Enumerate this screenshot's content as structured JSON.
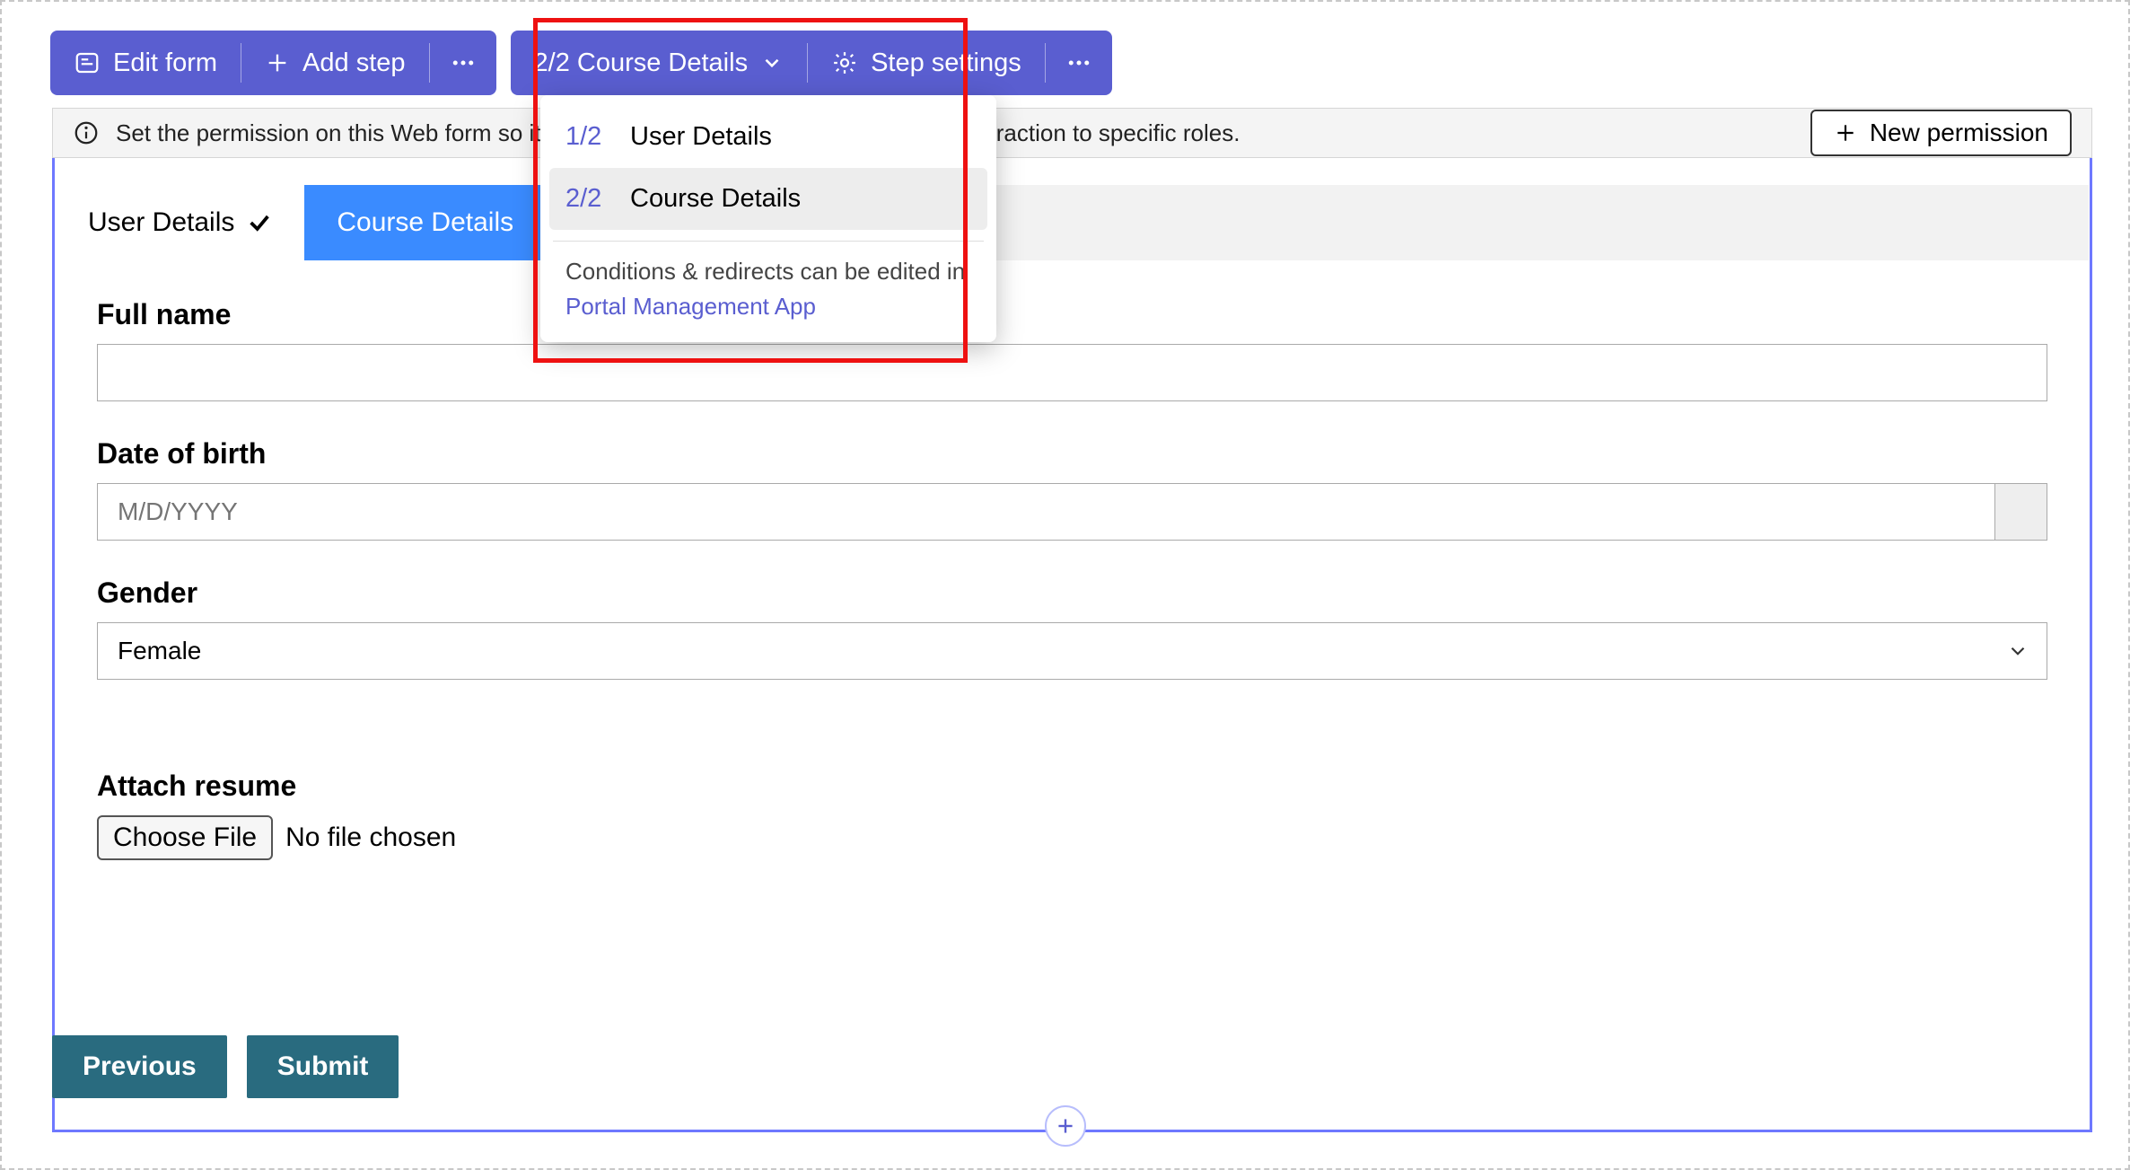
{
  "toolbar": {
    "edit_form": "Edit form",
    "add_step": "Add step",
    "step_label": "2/2 Course Details",
    "step_settings": "Step settings"
  },
  "info": {
    "text": "Set the permission on this Web form so it can be seen from the portal, or limit the interaction to specific roles.",
    "new_permission": "New permission"
  },
  "tabs": {
    "user_details": "User Details",
    "course_details": "Course Details"
  },
  "dropdown": {
    "items": [
      {
        "idx": "1/2",
        "label": "User Details"
      },
      {
        "idx": "2/2",
        "label": "Course Details"
      }
    ],
    "note_prefix": "Conditions & redirects can be edited in",
    "note_link": "Portal Management App"
  },
  "form": {
    "full_name_label": "Full name",
    "full_name_value": "",
    "dob_label": "Date of birth",
    "dob_placeholder": "M/D/YYYY",
    "gender_label": "Gender",
    "gender_value": "Female",
    "attach_label": "Attach resume",
    "choose_file": "Choose File",
    "no_file": "No file chosen"
  },
  "actions": {
    "previous": "Previous",
    "submit": "Submit"
  }
}
